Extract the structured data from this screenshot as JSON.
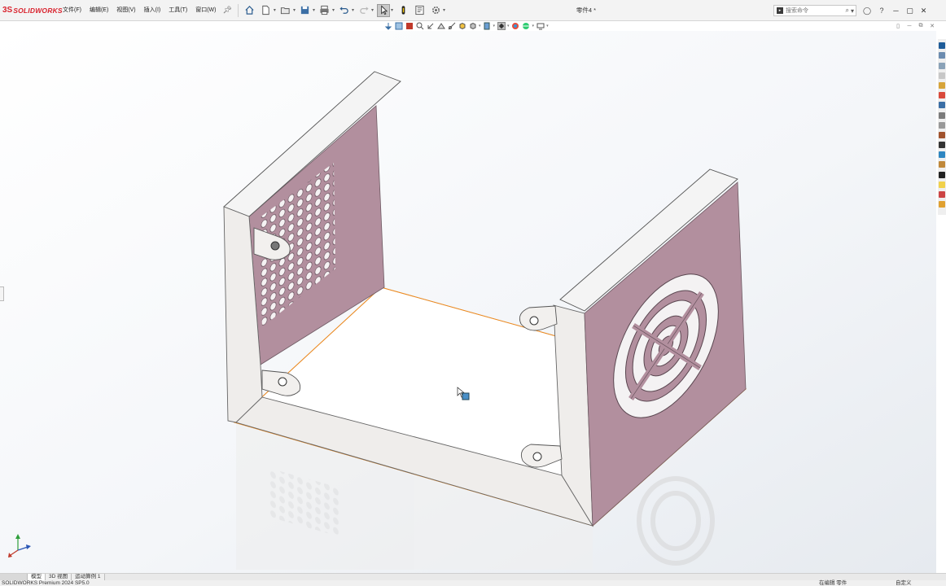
{
  "app": {
    "logo_mark": "3S",
    "logo_text": "SOLIDWORKS",
    "document_title": "零件4 *"
  },
  "menu": {
    "items": [
      {
        "label": "文件(F)"
      },
      {
        "label": "编辑(E)"
      },
      {
        "label": "视图(V)"
      },
      {
        "label": "插入(I)"
      },
      {
        "label": "工具(T)"
      },
      {
        "label": "窗口(W)"
      }
    ]
  },
  "search": {
    "placeholder": "搜索命令"
  },
  "bottom_tabs": [
    {
      "label": "模型",
      "active": true
    },
    {
      "label": "3D 视图",
      "active": false
    },
    {
      "label": "运动算例 1",
      "active": false
    }
  ],
  "statusbar": {
    "product": "SOLIDWORKS Premium 2024 SP5.0",
    "edit_state": "在编辑 零件",
    "units": "自定义"
  },
  "colors": {
    "accent_red": "#d9232e",
    "panel_face": "#b28f9e",
    "metal_light": "#f2f0ee",
    "selection_edge": "#f08a1c"
  },
  "icons": {
    "toolbar": [
      "home-icon",
      "new-document-icon",
      "open-icon",
      "save-icon",
      "print-icon",
      "undo-icon",
      "redo-icon",
      "select-icon",
      "rebuild-icon",
      "file-properties-icon",
      "options-icon"
    ],
    "task_pane": [
      "solidworks-resources-icon",
      "design-library-icon",
      "file-explorer-icon",
      "view-palette-icon",
      "appearances-icon",
      "custom-properties-icon",
      "toolbox-icon",
      "forum-icon"
    ]
  }
}
